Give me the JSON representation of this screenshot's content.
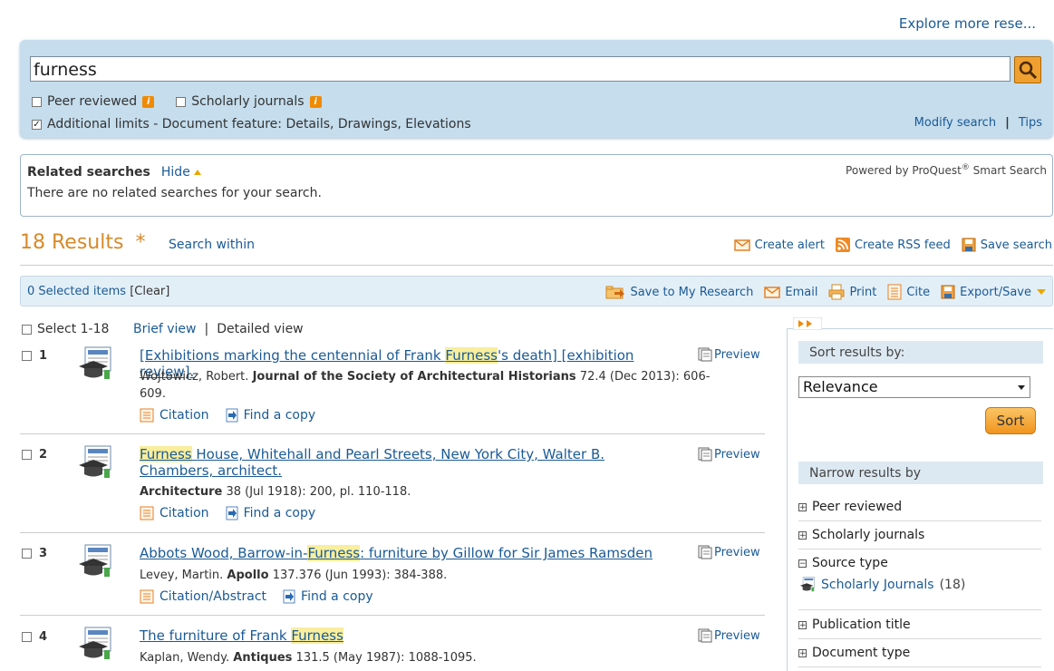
{
  "header": {
    "explore_link": "Explore more rese..."
  },
  "search": {
    "query": "furness",
    "peer_reviewed_label": "Peer reviewed",
    "scholarly_journals_label": "Scholarly journals",
    "additional_limits": "Additional limits - Document feature: Details, Drawings, Elevations",
    "modify_search": "Modify search",
    "separator": "|",
    "tips": "Tips"
  },
  "related": {
    "title": "Related searches",
    "hide": "Hide",
    "powered_by": "Powered by ProQuest",
    "reg": "®",
    "smart_search": " Smart Search",
    "message": "There are no related searches for your search."
  },
  "results_header": {
    "count": "18 Results",
    "asterisk": "*",
    "search_within": "Search within",
    "create_alert": "Create alert",
    "create_rss": "Create RSS feed",
    "save_search": "Save search"
  },
  "selection_bar": {
    "selected": "0 Selected items",
    "clear": "[Clear]",
    "save_research": "Save to My Research",
    "email": "Email",
    "print": "Print",
    "cite": "Cite",
    "export": "Export/Save"
  },
  "list_controls": {
    "select_range": "Select 1-18",
    "brief_view": "Brief view",
    "separator": "|",
    "detailed_view": "Detailed view"
  },
  "results": [
    {
      "num": "1",
      "title_pre": "[Exhibitions marking the centennial of Frank ",
      "title_hl": "Furness",
      "title_post": "'s death] [exhibition review].",
      "author": "Wojtowicz, Robert.",
      "source": "Journal of the Society of Architectural Historians",
      "details": "72.4  (Dec 2013): 606-609.",
      "link1": "Citation",
      "link2": "Find a copy",
      "preview": "Preview"
    },
    {
      "num": "2",
      "title_pre": "",
      "title_hl": "Furness",
      "title_post": " House, Whitehall and Pearl Streets, New York City, Walter B. Chambers, architect.",
      "author": "",
      "source": "Architecture",
      "details": "38  (Jul 1918): 200, pl. 110-118.",
      "link1": "Citation",
      "link2": "Find a copy",
      "preview": "Preview"
    },
    {
      "num": "3",
      "title_pre": "Abbots Wood, Barrow-in-",
      "title_hl": "Furness",
      "title_post": ": furniture by Gillow for Sir James Ramsden",
      "author": "Levey, Martin.",
      "source": "Apollo",
      "details": "137.376  (Jun 1993): 384-388.",
      "link1": "Citation/Abstract",
      "link2": "Find a copy",
      "preview": "Preview"
    },
    {
      "num": "4",
      "title_pre": "The furniture of Frank ",
      "title_hl": "Furness",
      "title_post": "",
      "author": "Kaplan, Wendy.",
      "source": "Antiques",
      "details": "131.5  (May 1987): 1088-1095.",
      "link1": "",
      "link2": "",
      "preview": "Preview"
    }
  ],
  "sidebar": {
    "sort_heading": "Sort results by:",
    "sort_value": "Relevance",
    "sort_button": "Sort",
    "narrow_heading": "Narrow results by",
    "facets": [
      "Peer reviewed",
      "Scholarly journals",
      "Source type",
      "Publication title",
      "Document type"
    ],
    "source_type_item": "Scholarly Journals",
    "source_type_count": "(18)"
  },
  "colors": {
    "accent_orange": "#d78a2a",
    "link_blue": "#1a5a96",
    "search_panel": "#c5dded",
    "highlight": "#f8ee9c"
  }
}
